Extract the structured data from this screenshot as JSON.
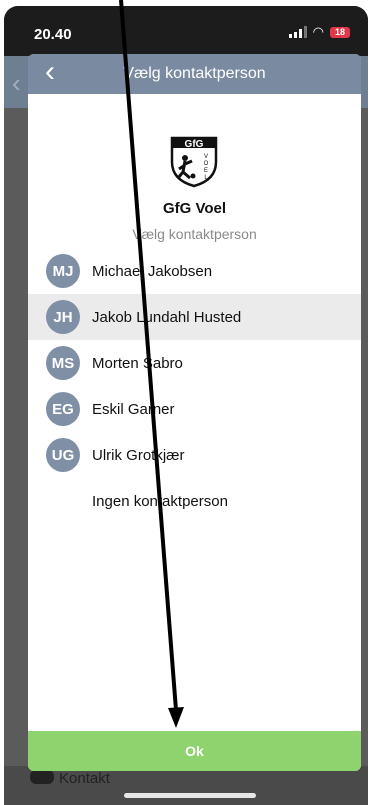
{
  "status_bar": {
    "time": "20.40",
    "battery": "18"
  },
  "modal": {
    "title": "Vælg kontaktperson",
    "club_name": "GfG Voel",
    "subtitle": "Vælg kontaktperson",
    "ok_label": "Ok"
  },
  "contacts": [
    {
      "initials": "MJ",
      "name": "Michael Jakobsen",
      "selected": false
    },
    {
      "initials": "JH",
      "name": "Jakob Lundahl Husted",
      "selected": true
    },
    {
      "initials": "MS",
      "name": "Morten Sabro",
      "selected": false
    },
    {
      "initials": "EG",
      "name": "Eskil Garner",
      "selected": false
    },
    {
      "initials": "UG",
      "name": "Ulrik Grotkjær",
      "selected": false
    }
  ],
  "no_contact_label": "Ingen kontaktperson",
  "background": {
    "bottom_label": "Kontakt"
  },
  "colors": {
    "header": "#7a8aa0",
    "avatar": "#7f8fa6",
    "ok_button": "#8fd36f",
    "selected_row": "#ebebeb"
  },
  "icons": {
    "back": "chevron-left-icon",
    "logo": "gfg-voel-logo"
  }
}
